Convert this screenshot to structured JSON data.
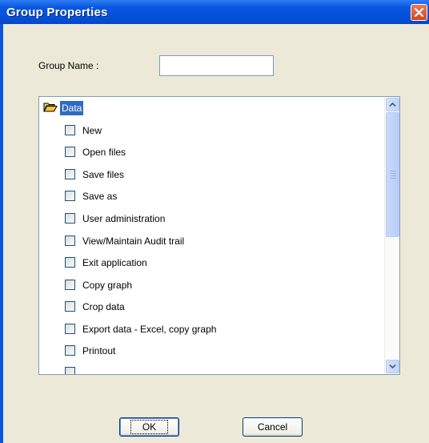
{
  "window": {
    "title": "Group Properties",
    "close_icon": "close-icon"
  },
  "form": {
    "group_name_label": "Group Name :",
    "group_name_value": ""
  },
  "tree": {
    "root_label": "Data",
    "root_icon": "open-folder-icon",
    "items": [
      {
        "label": "New",
        "checked": false
      },
      {
        "label": "Open files",
        "checked": false
      },
      {
        "label": "Save files",
        "checked": false
      },
      {
        "label": "Save as",
        "checked": false
      },
      {
        "label": "User administration",
        "checked": false
      },
      {
        "label": "View/Maintain Audit trail",
        "checked": false
      },
      {
        "label": "Exit application",
        "checked": false
      },
      {
        "label": "Copy graph",
        "checked": false
      },
      {
        "label": "Crop data",
        "checked": false
      },
      {
        "label": "Export data - Excel, copy graph",
        "checked": false
      },
      {
        "label": "Printout",
        "checked": false
      }
    ]
  },
  "buttons": {
    "ok_label": "OK",
    "cancel_label": "Cancel"
  },
  "colors": {
    "titlebar": "#0a55dc",
    "selection": "#316ac5",
    "dialog_bg": "#ece9d8",
    "close_button": "#d6461c"
  }
}
